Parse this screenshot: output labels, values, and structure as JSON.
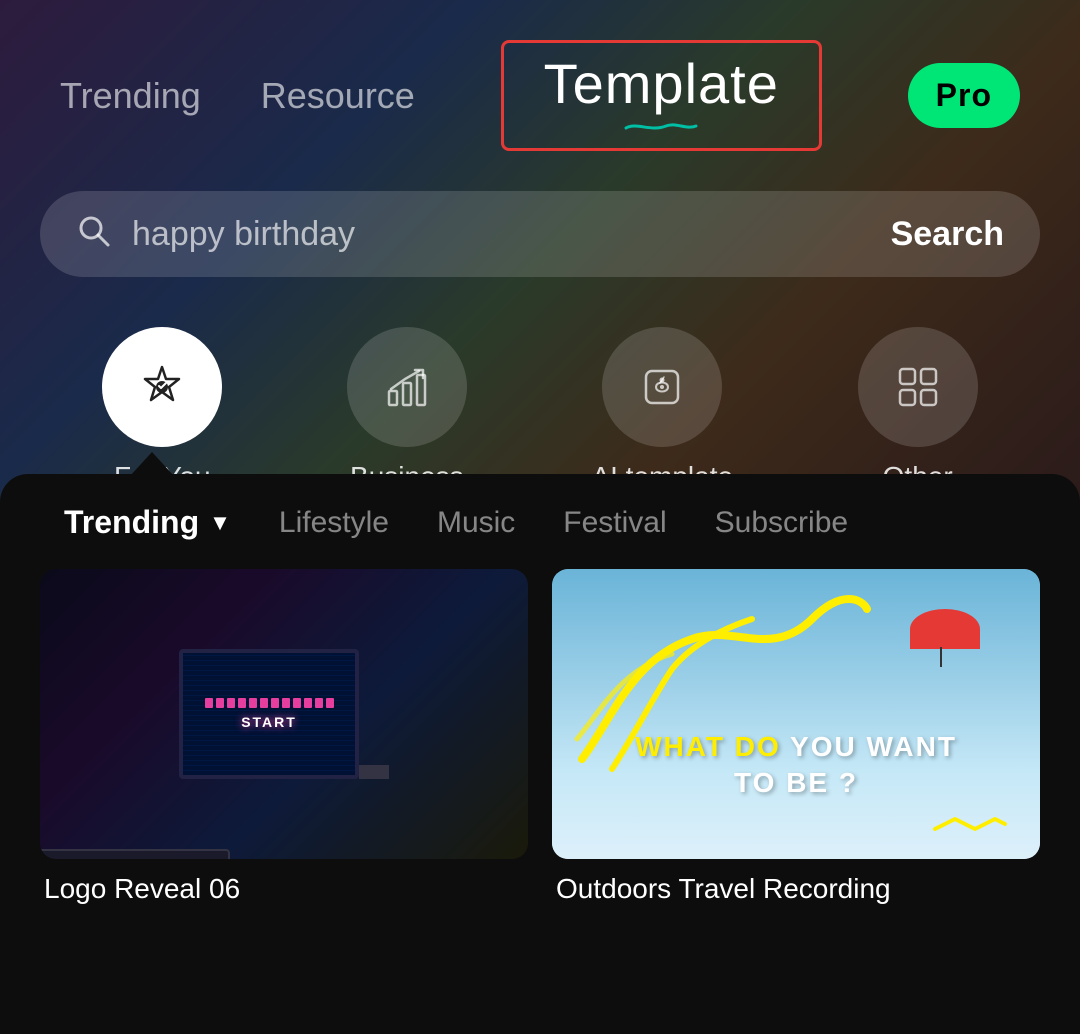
{
  "nav": {
    "trending_label": "Trending",
    "resource_label": "Resource",
    "template_label": "Template",
    "pro_label": "Pro"
  },
  "search": {
    "placeholder": "happy birthday",
    "button_label": "Search",
    "icon": "search-icon"
  },
  "categories": [
    {
      "id": "for-you",
      "label": "For You",
      "active": true
    },
    {
      "id": "business",
      "label": "Business",
      "active": false
    },
    {
      "id": "ai-template",
      "label": "AI template",
      "active": false
    },
    {
      "id": "other",
      "label": "Other",
      "active": false
    }
  ],
  "filter_tabs": [
    {
      "id": "trending",
      "label": "Trending",
      "active": true
    },
    {
      "id": "lifestyle",
      "label": "Lifestyle",
      "active": false
    },
    {
      "id": "music",
      "label": "Music",
      "active": false
    },
    {
      "id": "festival",
      "label": "Festival",
      "active": false
    },
    {
      "id": "subscribe",
      "label": "Subscribe",
      "active": false
    }
  ],
  "templates": [
    {
      "id": "logo-reveal-06",
      "title": "Logo Reveal 06"
    },
    {
      "id": "outdoors-travel",
      "title": "Outdoors Travel Recording"
    }
  ]
}
